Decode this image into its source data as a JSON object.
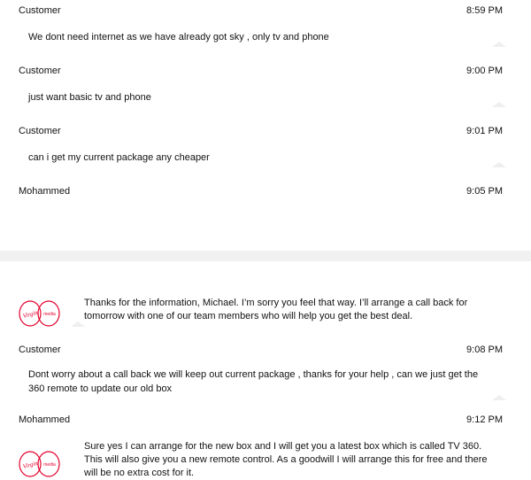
{
  "messages": [
    {
      "sender": "Customer",
      "time": "8:59 PM",
      "text": "We dont need internet as we have already got sky , only tv and phone"
    },
    {
      "sender": "Customer",
      "time": "9:00 PM",
      "text": "just want basic tv and phone"
    },
    {
      "sender": "Customer",
      "time": "9:01 PM",
      "text": "can i get my current package any cheaper"
    },
    {
      "sender": "Mohammed",
      "time": "9:05 PM",
      "text": "Thanks for the information, Michael. I’m sorry you feel that way. I’ll arrange a call back for tomorrow with one of our team members who will help you get the best deal."
    },
    {
      "sender": "Customer",
      "time": "9:08 PM",
      "text": "Dont worry about a call back we will keep out current package , thanks for your help , can we just get the 360 remote to update our old box"
    },
    {
      "sender": "Mohammed",
      "time": "9:12 PM",
      "text": "Sure yes I can arrange for the new box and I will get you a latest box which is called TV 360. This will also give you a new remote control. As a goodwill I will arrange this for free and there will be no extra cost for it."
    }
  ],
  "brand": {
    "accent": "#e4002b",
    "logo_label": "Virgin media"
  }
}
